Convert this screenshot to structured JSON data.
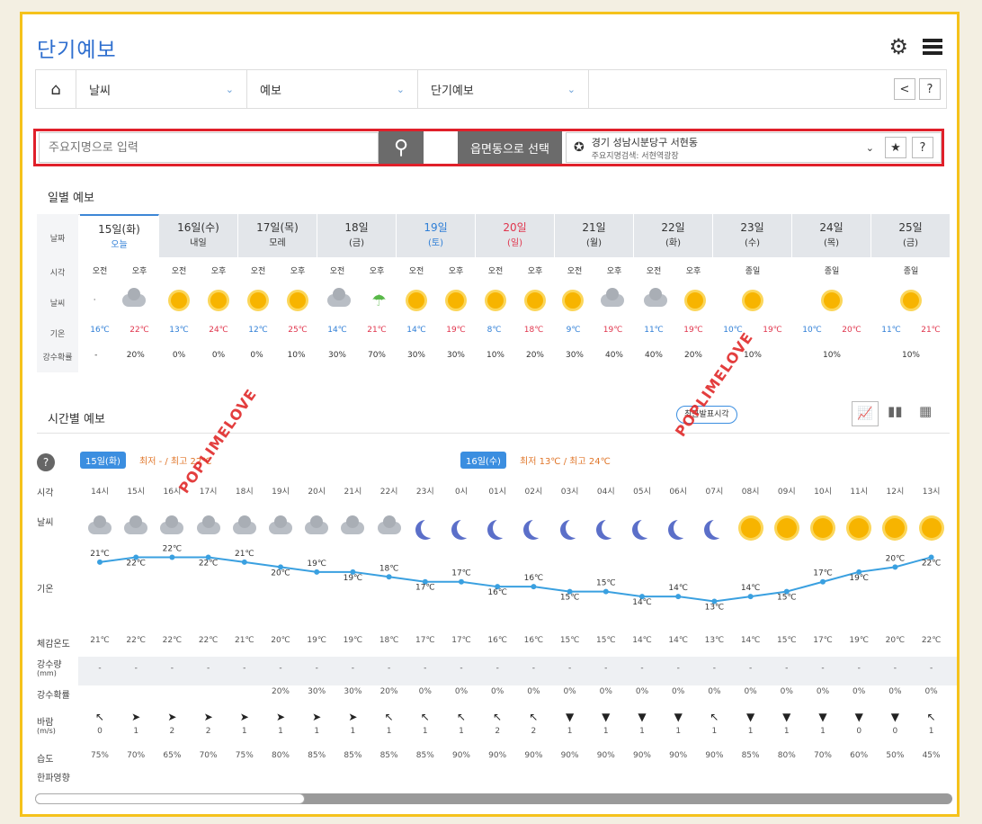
{
  "header": {
    "title": "단기예보"
  },
  "nav": {
    "items": [
      "날씨",
      "예보",
      "단기예보"
    ]
  },
  "search": {
    "placeholder": "주요지명으로 입력",
    "emd_button": "읍면동으로 선택",
    "location": "경기 성남시분당구 서현동",
    "sub": "주요지명검색: 서현역광장"
  },
  "daily": {
    "section_title": "일별 예보",
    "row_labels": [
      "날짜",
      "시각",
      "날씨",
      "기온",
      "강수확률"
    ],
    "days": [
      {
        "date": "15일(화)",
        "label": "오늘",
        "color": "#333",
        "ampm": [
          "오전",
          "오후"
        ],
        "icons": [
          "dot",
          "cloud"
        ],
        "temps": [
          "16℃",
          "22℃"
        ],
        "pops": [
          "-",
          "20%"
        ]
      },
      {
        "date": "16일(수)",
        "label": "내일",
        "color": "#333",
        "ampm": [
          "오전",
          "오후"
        ],
        "icons": [
          "sun",
          "sun"
        ],
        "temps": [
          "13℃",
          "24℃"
        ],
        "pops": [
          "0%",
          "0%"
        ]
      },
      {
        "date": "17일(목)",
        "label": "모레",
        "color": "#333",
        "ampm": [
          "오전",
          "오후"
        ],
        "icons": [
          "sun",
          "sun"
        ],
        "temps": [
          "12℃",
          "25℃"
        ],
        "pops": [
          "0%",
          "10%"
        ]
      },
      {
        "date": "18일",
        "label": "(금)",
        "color": "#333",
        "ampm": [
          "오전",
          "오후"
        ],
        "icons": [
          "cloud",
          "umb"
        ],
        "temps": [
          "14℃",
          "21℃"
        ],
        "pops": [
          "30%",
          "70%"
        ]
      },
      {
        "date": "19일",
        "label": "(토)",
        "color": "#2e7ed6",
        "ampm": [
          "오전",
          "오후"
        ],
        "icons": [
          "sun",
          "sun"
        ],
        "temps": [
          "14℃",
          "19℃"
        ],
        "pops": [
          "30%",
          "30%"
        ]
      },
      {
        "date": "20일",
        "label": "(일)",
        "color": "#e0344c",
        "ampm": [
          "오전",
          "오후"
        ],
        "icons": [
          "sun",
          "sun"
        ],
        "temps": [
          "8℃",
          "18℃"
        ],
        "pops": [
          "10%",
          "20%"
        ]
      },
      {
        "date": "21일",
        "label": "(월)",
        "color": "#333",
        "ampm": [
          "오전",
          "오후"
        ],
        "icons": [
          "sun",
          "cloud"
        ],
        "temps": [
          "9℃",
          "19℃"
        ],
        "pops": [
          "30%",
          "40%"
        ]
      },
      {
        "date": "22일",
        "label": "(화)",
        "color": "#333",
        "ampm": [
          "오전",
          "오후"
        ],
        "icons": [
          "cloud",
          "sun"
        ],
        "temps": [
          "11℃",
          "19℃"
        ],
        "pops": [
          "40%",
          "20%"
        ]
      },
      {
        "date": "23일",
        "label": "(수)",
        "color": "#333",
        "ampm": [
          "종일"
        ],
        "icons": [
          "sun"
        ],
        "temps": [
          "10℃",
          "19℃"
        ],
        "pops": [
          "10%"
        ]
      },
      {
        "date": "24일",
        "label": "(목)",
        "color": "#333",
        "ampm": [
          "종일"
        ],
        "icons": [
          "sun"
        ],
        "temps": [
          "10℃",
          "20℃"
        ],
        "pops": [
          "10%"
        ]
      },
      {
        "date": "25일",
        "label": "(금)",
        "color": "#333",
        "ampm": [
          "종일"
        ],
        "icons": [
          "sun"
        ],
        "temps": [
          "11℃",
          "21℃"
        ],
        "pops": [
          "10%"
        ]
      }
    ]
  },
  "hourly": {
    "section_title": "시간별 예보",
    "recent_btn": "최근발표시각",
    "badge1": "15일(화)",
    "badge1_text": "최저 - / 최고 22℃",
    "badge2": "16일(수)",
    "badge2_text": "최저 13℃ / 최고 24℃",
    "row_labels": [
      "시각",
      "날씨",
      "기온",
      "체감온도",
      "강수량",
      "(mm)",
      "강수확률",
      "바람",
      "(m/s)",
      "습도",
      "한파영향"
    ],
    "hours": [
      "14시",
      "15시",
      "16시",
      "17시",
      "18시",
      "19시",
      "20시",
      "21시",
      "22시",
      "23시",
      "0시",
      "01시",
      "02시",
      "03시",
      "04시",
      "05시",
      "06시",
      "07시",
      "08시",
      "09시",
      "10시",
      "11시",
      "12시",
      "13시"
    ],
    "icons": [
      "cloud",
      "cloud",
      "cloud",
      "cloud",
      "cloud",
      "cloud",
      "cloud",
      "cloud",
      "cloud",
      "moon",
      "moon",
      "moon",
      "moon",
      "moon",
      "moon",
      "moon",
      "moon",
      "moon",
      "sun",
      "sun",
      "sun",
      "sun",
      "sun",
      "sun"
    ],
    "temps": [
      21,
      22,
      22,
      22,
      21,
      20,
      19,
      19,
      18,
      17,
      17,
      16,
      16,
      15,
      15,
      14,
      14,
      13,
      14,
      15,
      17,
      19,
      20,
      22
    ],
    "feels": [
      "21℃",
      "22℃",
      "22℃",
      "22℃",
      "21℃",
      "20℃",
      "19℃",
      "19℃",
      "18℃",
      "17℃",
      "17℃",
      "16℃",
      "16℃",
      "15℃",
      "15℃",
      "14℃",
      "14℃",
      "13℃",
      "14℃",
      "15℃",
      "17℃",
      "19℃",
      "20℃",
      "22℃"
    ],
    "precip": [
      "-",
      "-",
      "-",
      "-",
      "-",
      "-",
      "-",
      "-",
      "-",
      "-",
      "-",
      "-",
      "-",
      "-",
      "-",
      "-",
      "-",
      "-",
      "-",
      "-",
      "-",
      "-",
      "-",
      "-"
    ],
    "pop": [
      "",
      "",
      "",
      "",
      "",
      "20%",
      "30%",
      "30%",
      "20%",
      "0%",
      "0%",
      "0%",
      "0%",
      "0%",
      "0%",
      "0%",
      "0%",
      "0%",
      "0%",
      "0%",
      "0%",
      "0%",
      "0%",
      "0%"
    ],
    "wind_dir": [
      "↖",
      "➤",
      "➤",
      "➤",
      "➤",
      "➤",
      "➤",
      "➤",
      "↖",
      "↖",
      "↖",
      "↖",
      "↖",
      "▼",
      "▼",
      "▼",
      "▼",
      "↖",
      "▼",
      "▼",
      "▼",
      "▼",
      "▼",
      "↖"
    ],
    "wind_spd": [
      "0",
      "1",
      "2",
      "2",
      "1",
      "1",
      "1",
      "1",
      "1",
      "1",
      "1",
      "2",
      "2",
      "1",
      "1",
      "1",
      "1",
      "1",
      "1",
      "1",
      "1",
      "0",
      "0",
      "1"
    ],
    "humidity": [
      "75%",
      "70%",
      "65%",
      "70%",
      "75%",
      "80%",
      "85%",
      "85%",
      "85%",
      "85%",
      "90%",
      "90%",
      "90%",
      "90%",
      "90%",
      "90%",
      "90%",
      "90%",
      "85%",
      "80%",
      "70%",
      "60%",
      "50%",
      "45%"
    ]
  },
  "watermark": "POPLIMELOVE"
}
